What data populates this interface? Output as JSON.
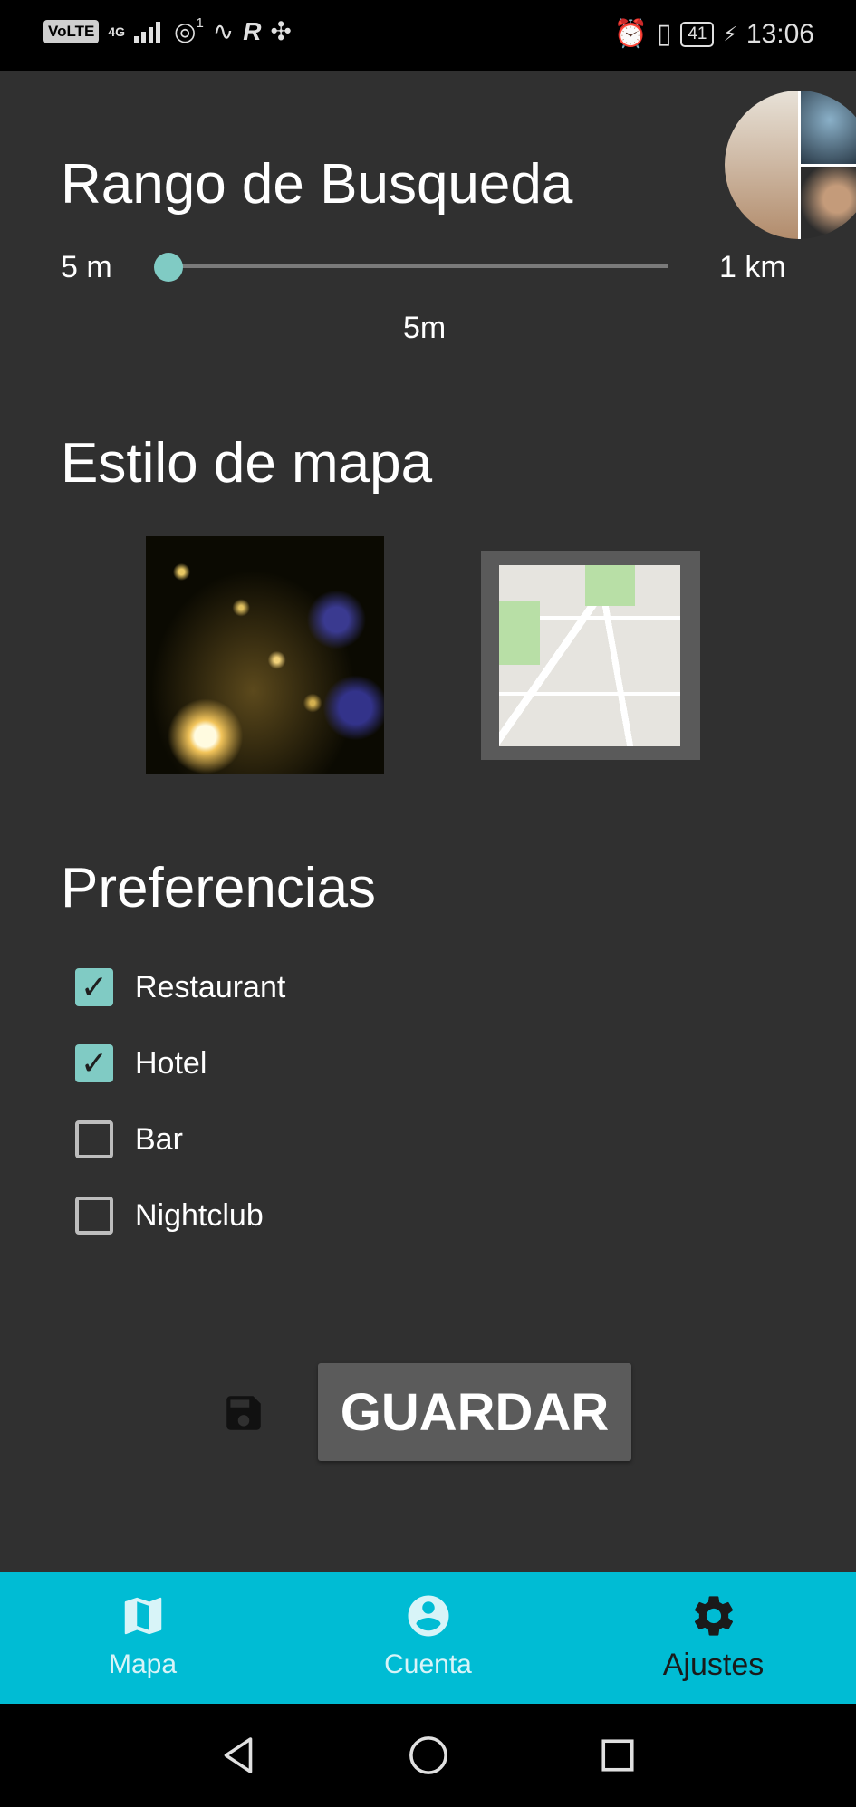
{
  "status_bar": {
    "volte": "VoLTE",
    "network": "4G",
    "sim_index": "1",
    "battery": "41",
    "time": "13:06"
  },
  "range": {
    "title": "Rango de Busqueda",
    "min_label": "5 m",
    "max_label": "1 km",
    "value_label": "5m",
    "value_fraction": 0
  },
  "map_style": {
    "title": "Estilo de mapa",
    "options": [
      {
        "icon": "night-map-thumbnail",
        "selected": false
      },
      {
        "icon": "standard-map-thumbnail",
        "selected": true
      }
    ]
  },
  "preferences": {
    "title": "Preferencias",
    "items": [
      {
        "label": "Restaurant",
        "checked": true
      },
      {
        "label": "Hotel",
        "checked": true
      },
      {
        "label": "Bar",
        "checked": false
      },
      {
        "label": "Nightclub",
        "checked": false
      }
    ]
  },
  "save": {
    "label": "GUARDAR",
    "icon": "floppy-disk-icon"
  },
  "bottom_nav": {
    "items": [
      {
        "label": "Mapa",
        "icon": "map-icon",
        "active": false
      },
      {
        "label": "Cuenta",
        "icon": "account-circle-icon",
        "active": false
      },
      {
        "label": "Ajustes",
        "icon": "gear-icon",
        "active": true
      }
    ]
  },
  "colors": {
    "background": "#303030",
    "accent": "#80cbc4",
    "nav_bar": "#00bcd4",
    "button": "#5b5b5b"
  }
}
